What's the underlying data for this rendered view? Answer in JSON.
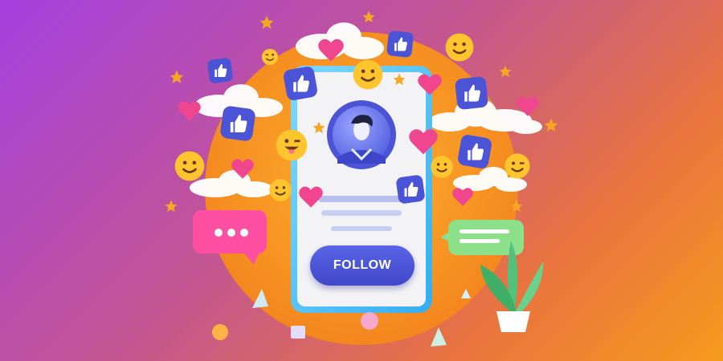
{
  "colors": {
    "bg_top_left": "#a63fe0",
    "bg_bottom_right": "#f79a1c",
    "sun_circle": "#f6931f",
    "phone_frame": "#4fc6f5",
    "phone_screen": "#f3f3f6",
    "accent_blue": "#4b53d6",
    "heart_pink": "#f0468f",
    "emoji_yellow": "#ffc52e",
    "pink_bubble": "#ff4fa3",
    "green_bubble": "#8de08a"
  },
  "profile": {
    "avatar_icon": "user-avatar-icon",
    "follow_label": "FOLLOW"
  },
  "decorations": {
    "icons": [
      "like-icon",
      "heart-icon",
      "smiley-icon",
      "wink-icon",
      "star-icon",
      "cloud-icon",
      "chat-bubble-icon",
      "message-bubble-icon",
      "plant-icon"
    ]
  }
}
